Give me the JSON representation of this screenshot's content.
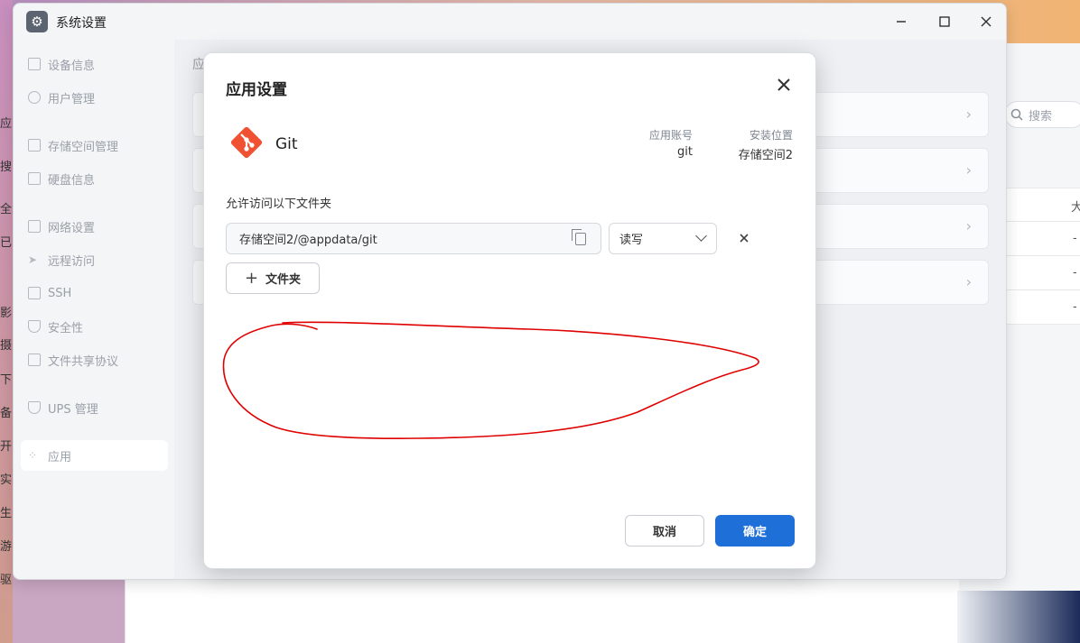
{
  "window": {
    "title": "系统设置",
    "controls": [
      "minimize",
      "maximize",
      "close"
    ]
  },
  "sidebar": {
    "items": [
      {
        "label": "设备信息",
        "icon": "device-icon"
      },
      {
        "label": "用户管理",
        "icon": "user-icon"
      },
      {
        "label": "存储空间管理",
        "icon": "storage-icon"
      },
      {
        "label": "硬盘信息",
        "icon": "disk-icon"
      },
      {
        "label": "网络设置",
        "icon": "network-icon"
      },
      {
        "label": "远程访问",
        "icon": "send-icon"
      },
      {
        "label": "SSH",
        "icon": "terminal-icon"
      },
      {
        "label": "安全性",
        "icon": "shield-icon"
      },
      {
        "label": "文件共享协议",
        "icon": "file-icon"
      },
      {
        "label": "UPS 管理",
        "icon": "ups-icon"
      },
      {
        "label": "应用",
        "icon": "apps-icon",
        "active": true
      }
    ]
  },
  "content": {
    "heading_partial": "应"
  },
  "background": {
    "search_placeholder": "搜索",
    "col_header_partial": "大",
    "rows": [
      "-",
      "-",
      "-"
    ],
    "left_chars": [
      "应",
      "搜",
      "全",
      "已",
      "影",
      "摄",
      "下",
      "备",
      "开",
      "实",
      "生",
      "游",
      "驱"
    ]
  },
  "dialog": {
    "title": "应用设置",
    "app": {
      "name": "Git",
      "account_label": "应用账号",
      "account_value": "git",
      "location_label": "安装位置",
      "location_value": "存储空间2"
    },
    "folders_label": "允许访问以下文件夹",
    "folders": [
      {
        "path": "存储空间2/@appdata/git",
        "permission": "读写"
      }
    ],
    "add_folder_label": "文件夹",
    "cancel_label": "取消",
    "ok_label": "确定"
  },
  "colors": {
    "primary": "#1f6fd8",
    "git_brand": "#f05133",
    "annotation": "#e00000"
  }
}
